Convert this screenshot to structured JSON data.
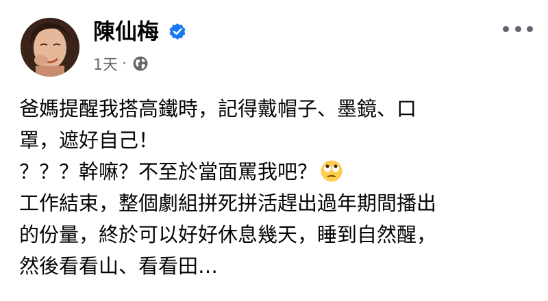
{
  "post": {
    "author": "陳仙梅",
    "time": "1天",
    "dot": "·",
    "visibility_icon": "globe-icon",
    "verified_icon": "verified-badge-icon",
    "more_icon": "more-options-icon",
    "body_lines": [
      "爸媽提醒我搭高鐵時，記得戴帽子、墨鏡、口",
      "罩，遮好自己！",
      "？？？幹嘛？不至於當面罵我吧？",
      "工作結束，整個劇組拼死拼活趕出過年期間播出",
      "的份量，終於可以好好休息幾天，睡到自然醒，",
      "然後看看山、看看田…"
    ],
    "emoji": "face-with-rolling-eyes-icon"
  },
  "colors": {
    "verified_blue": "#1877f2",
    "meta_gray": "#65676b",
    "text": "#050505"
  }
}
